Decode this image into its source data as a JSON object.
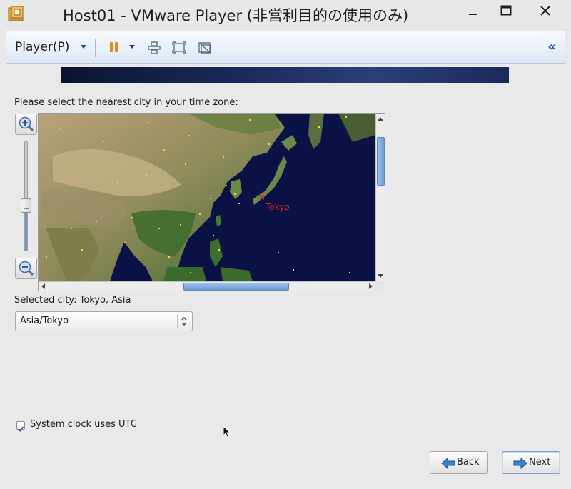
{
  "window": {
    "title": "Host01 - VMware Player (非営利目的の使用のみ)"
  },
  "toolbar": {
    "player_menu": "Player(P)",
    "icons": [
      "pause-icon",
      "send-ctrl-alt-del-icon",
      "fullscreen-icon",
      "unity-icon",
      "collapse-icon"
    ],
    "collapse_glyph": "«"
  },
  "installer": {
    "prompt": "Please select the nearest city in your time zone:",
    "map": {
      "highlighted_city": "Tokyo",
      "zoom_level": 0.4,
      "vertical_scroll": 0.14,
      "horizontal_scroll": 0.64
    },
    "selected_city_text": "Selected city: Tokyo, Asia",
    "timezone_select": {
      "value": "Asia/Tokyo"
    },
    "utc_checkbox": {
      "label": "System clock uses UTC",
      "checked": true
    },
    "buttons": {
      "back": "Back",
      "next": "Next"
    }
  },
  "colors": {
    "accent": "#1d4f9c",
    "pause": "#e2881c",
    "city_marker": "#e0241f",
    "map_ocean": "#0a1245"
  }
}
